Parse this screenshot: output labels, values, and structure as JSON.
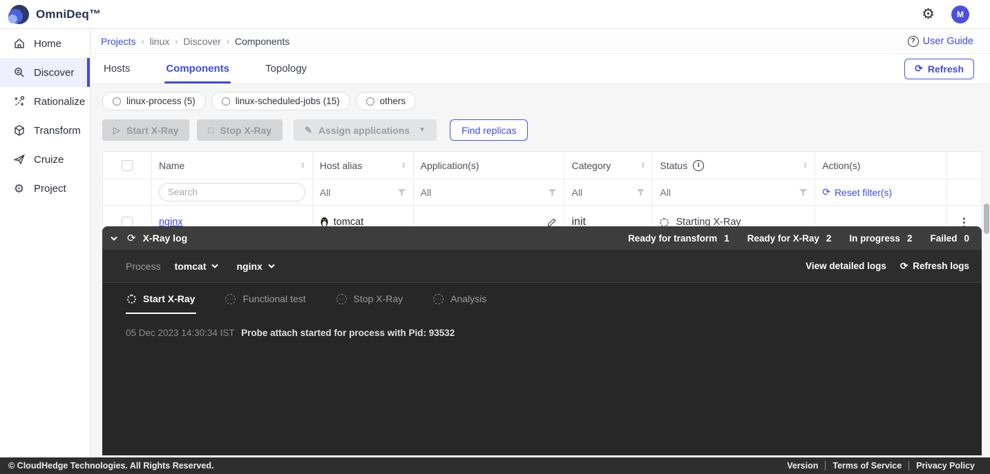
{
  "app": {
    "title": "OmniDeq™",
    "avatar_initial": "M"
  },
  "colors": {
    "accent": "#3d4be0",
    "avatar": "#4a50e0",
    "panel_dark": "#272727"
  },
  "sidebar": {
    "items": [
      {
        "label": "Home",
        "icon": "home-icon",
        "active": false
      },
      {
        "label": "Discover",
        "icon": "magnifier-icon",
        "active": true
      },
      {
        "label": "Rationalize",
        "icon": "strategy-icon",
        "active": false
      },
      {
        "label": "Transform",
        "icon": "cube-icon",
        "active": false
      },
      {
        "label": "Cruize",
        "icon": "paper-plane-icon",
        "active": false
      },
      {
        "label": "Project",
        "icon": "gear-icon",
        "active": false
      }
    ]
  },
  "breadcrumb": {
    "items": [
      "Projects",
      "linux",
      "Discover",
      "Components"
    ],
    "user_guide": "User Guide"
  },
  "tabs": {
    "hosts": "Hosts",
    "components": "Components",
    "topology": "Topology",
    "refresh_label": "Refresh"
  },
  "chips": [
    {
      "label": "linux-process (5)"
    },
    {
      "label": "linux-scheduled-jobs (15)"
    },
    {
      "label": "others"
    }
  ],
  "actions": {
    "start_xray": "Start X-Ray",
    "stop_xray": "Stop X-Ray",
    "assign_applications": "Assign applications",
    "find_replicas": "Find replicas"
  },
  "table": {
    "columns": [
      "Name",
      "Host alias",
      "Application(s)",
      "Category",
      "Status",
      "Action(s)"
    ],
    "search_placeholder": "Search",
    "filter_all": "All",
    "reset_label": "Reset filter(s)",
    "rows": [
      {
        "name": "nginx",
        "host_alias": "tomcat",
        "applications": "",
        "category": "init",
        "status": "Starting X-Ray"
      }
    ]
  },
  "xray": {
    "title": "X-Ray log",
    "counters": [
      {
        "label": "Ready for transform",
        "value": 1
      },
      {
        "label": "Ready for X-Ray",
        "value": 2
      },
      {
        "label": "In progress",
        "value": 2
      },
      {
        "label": "Failed",
        "value": 0
      }
    ],
    "process_label": "Process",
    "processes": [
      {
        "name": "tomcat"
      },
      {
        "name": "nginx"
      }
    ],
    "view_logs_label": "View detailed logs",
    "refresh_logs_label": "Refresh logs",
    "tabs": [
      {
        "label": "Start X-Ray",
        "active": true
      },
      {
        "label": "Functional test",
        "active": false
      },
      {
        "label": "Stop X-Ray",
        "active": false
      },
      {
        "label": "Analysis",
        "active": false
      }
    ],
    "log": {
      "timestamp": "05 Dec 2023 14:30:34 IST",
      "message": "Probe attach started for process with Pid: 93532"
    }
  },
  "footer": {
    "copyright": "© CloudHedge Technologies. All Rights Reserved.",
    "links": [
      "Version",
      "Terms of Service",
      "Privacy Policy"
    ]
  }
}
